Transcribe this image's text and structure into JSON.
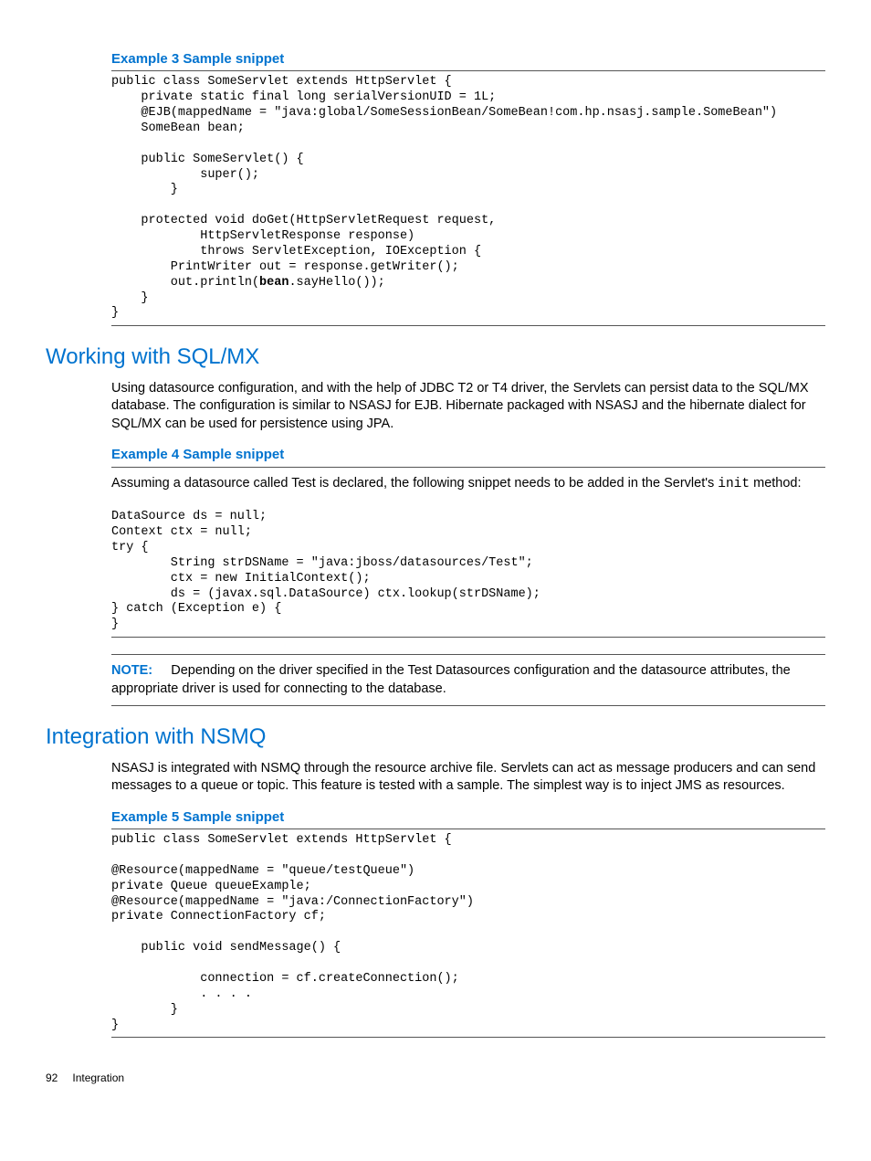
{
  "example3": {
    "heading": "Example 3 Sample snippet",
    "code": "public class SomeServlet extends HttpServlet {\n    private static final long serialVersionUID = 1L;\n    @EJB(mappedName = \"java:global/SomeSessionBean/SomeBean!com.hp.nsasj.sample.SomeBean\")\n    SomeBean bean;\n\n    public SomeServlet() {\n            super();\n        }\n\n    protected void doGet(HttpServletRequest request,\n            HttpServletResponse response)\n            throws ServletException, IOException {\n        PrintWriter out = response.getWriter();\n        out.println(",
    "code_bold": "bean",
    "code_after": ".sayHello());\n    }\n}"
  },
  "section1": {
    "heading": "Working with SQL/MX",
    "para": "Using datasource configuration, and with the help of JDBC T2 or T4 driver, the Servlets can persist data to the SQL/MX database. The configuration is similar to NSASJ for EJB. Hibernate packaged with NSASJ and the hibernate dialect for SQL/MX can be used for persistence using JPA."
  },
  "example4": {
    "heading": "Example 4 Sample snippet",
    "intro_pre": "Assuming a datasource called Test is declared, the following snippet needs to be added in the Servlet's ",
    "intro_code": "init",
    "intro_post": " method:",
    "code": "DataSource ds = null;\nContext ctx = null;\ntry {\n        String strDSName = \"java:jboss/datasources/Test\";\n        ctx = new InitialContext();\n        ds = (javax.sql.DataSource) ctx.lookup(strDSName);\n} catch (Exception e) {\n}"
  },
  "note": {
    "label": "NOTE:",
    "text": "Depending on the driver specified in the Test Datasources configuration and the datasource attributes, the appropriate driver is used for connecting to the database."
  },
  "section2": {
    "heading": "Integration with NSMQ",
    "para": "NSASJ is integrated with NSMQ through the resource archive file. Servlets can act as message producers and can send messages to a queue or topic. This feature is tested with a sample. The simplest way is to inject JMS as resources."
  },
  "example5": {
    "heading": "Example 5 Sample snippet",
    "code": "public class SomeServlet extends HttpServlet {\n\n@Resource(mappedName = \"queue/testQueue\")\nprivate Queue queueExample;\n@Resource(mappedName = \"java:/ConnectionFactory\")\nprivate ConnectionFactory cf;\n\n    public void sendMessage() {\n\n            connection = cf.createConnection();\n            . . . .\n        }\n}"
  },
  "footer": {
    "page": "92",
    "title": "Integration"
  }
}
